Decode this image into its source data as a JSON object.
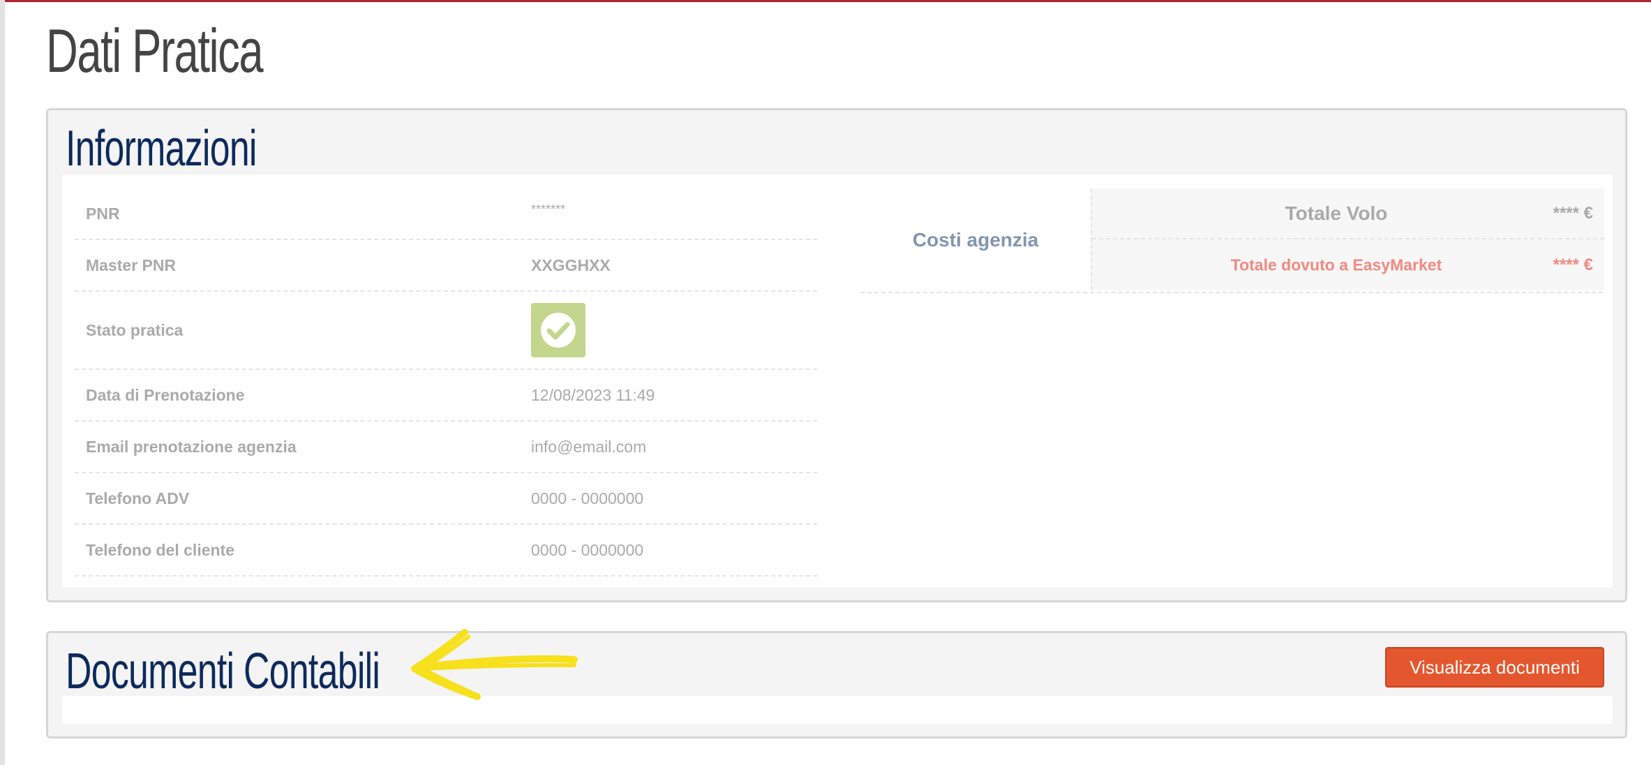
{
  "page": {
    "title": "Dati Pratica"
  },
  "info_panel": {
    "title": "Informazioni",
    "rows": [
      {
        "label": "PNR",
        "value": "*******"
      },
      {
        "label": "Master PNR",
        "value": "XXGGHXX"
      },
      {
        "label": "Stato pratica",
        "value": "",
        "icon": "check-icon"
      },
      {
        "label": "Data di Prenotazione",
        "value": "12/08/2023 11:49"
      },
      {
        "label": "Email prenotazione agenzia",
        "value": "info@email.com"
      },
      {
        "label": "Telefono ADV",
        "value": "0000 - 0000000"
      },
      {
        "label": "Telefono del cliente",
        "value": "0000 - 0000000"
      }
    ],
    "costs": {
      "label": "Costi agenzia",
      "items": [
        {
          "name": "Totale Volo",
          "amount": "**** €"
        },
        {
          "name": "Totale dovuto a EasyMarket",
          "amount": "**** €"
        }
      ]
    }
  },
  "docs_panel": {
    "title": "Documenti Contabili",
    "button_label": "Visualizza documenti"
  },
  "colors": {
    "brand_red": "#b1232c",
    "heading_blue": "#0d2a5c",
    "button_orange": "#e4572e",
    "status_green": "#c3d68e",
    "annotation_yellow": "#f7e01c"
  }
}
